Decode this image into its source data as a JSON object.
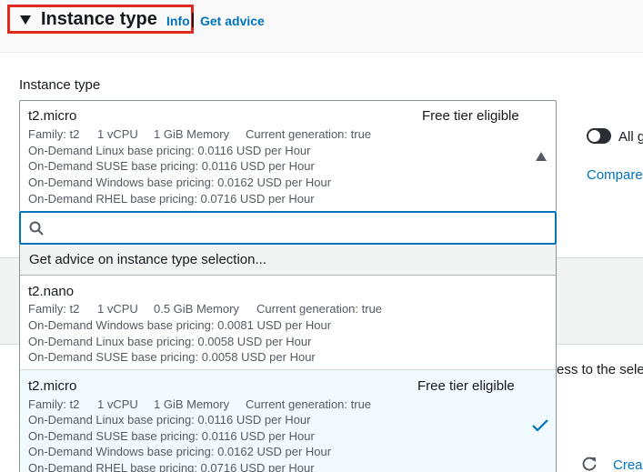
{
  "section": {
    "title": "Instance type",
    "info_label": "Info",
    "advice_label": "Get advice"
  },
  "field": {
    "label": "Instance type"
  },
  "selected": {
    "name": "t2.micro",
    "tag": "Free tier eligible",
    "family": "Family: t2",
    "vcpu": "1 vCPU",
    "memory": "1 GiB Memory",
    "generation": "Current generation: true",
    "pricing": [
      "On-Demand Linux base pricing: 0.0116 USD per Hour",
      "On-Demand SUSE base pricing: 0.0116 USD per Hour",
      "On-Demand Windows base pricing: 0.0162 USD per Hour",
      "On-Demand RHEL base pricing: 0.0716 USD per Hour"
    ]
  },
  "search": {
    "placeholder": "",
    "value": ""
  },
  "dropdown": {
    "advice_item": "Get advice on instance type selection...",
    "options": [
      {
        "name": "t2.nano",
        "tag": "",
        "family": "Family: t2",
        "vcpu": "1 vCPU",
        "memory": "0.5 GiB Memory",
        "generation": "Current generation: true",
        "pricing": [
          "On-Demand Windows base pricing: 0.0081 USD per Hour",
          "On-Demand Linux base pricing: 0.0058 USD per Hour",
          "On-Demand SUSE base pricing: 0.0058 USD per Hour"
        ]
      },
      {
        "name": "t2.micro",
        "tag": "Free tier eligible",
        "family": "Family: t2",
        "vcpu": "1 vCPU",
        "memory": "1 GiB Memory",
        "generation": "Current generation: true",
        "pricing": [
          "On-Demand Linux base pricing: 0.0116 USD per Hour",
          "On-Demand SUSE base pricing: 0.0116 USD per Hour",
          "On-Demand Windows base pricing: 0.0162 USD per Hour",
          "On-Demand RHEL base pricing: 0.0716 USD per Hour"
        ]
      }
    ]
  },
  "side": {
    "toggle_label": "All g",
    "compare_label": "Compare",
    "access_text": "ess to the sele",
    "create_label": "Creat"
  },
  "colors": {
    "link": "#0073bb",
    "highlight_border": "#e02a20",
    "selected_bg": "#f1faff",
    "check": "#0073bb"
  }
}
